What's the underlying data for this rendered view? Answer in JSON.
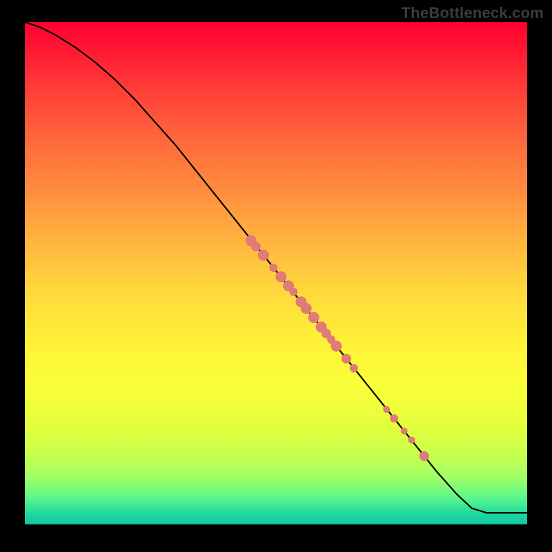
{
  "watermark": "TheBottleneck.com",
  "colors": {
    "gradient_top": "#ff0030",
    "gradient_mid": "#fff238",
    "gradient_bottom": "#10c9a0",
    "curve": "#000000",
    "marker_fill": "#e07b78",
    "marker_stroke": "#c95e5b"
  },
  "chart_data": {
    "type": "line",
    "title": "",
    "xlabel": "",
    "ylabel": "",
    "xlim": [
      0,
      100
    ],
    "ylim": [
      0,
      100
    ],
    "grid": false,
    "series": [
      {
        "name": "curve",
        "x": [
          0,
          3,
          6,
          10,
          14,
          18,
          22,
          26,
          30,
          34,
          38,
          42,
          46,
          50,
          54,
          58,
          62,
          66,
          70,
          74,
          78,
          82,
          86,
          89,
          92,
          100
        ],
        "y": [
          100,
          99,
          97.5,
          95,
          92,
          88.5,
          84.5,
          80,
          75.5,
          70.5,
          65.5,
          60.5,
          55.5,
          50.5,
          45.5,
          40.5,
          35.5,
          30.5,
          25.5,
          20.5,
          15.5,
          10.5,
          6,
          3.2,
          2.3,
          2.3
        ]
      }
    ],
    "markers": [
      {
        "x": 45.0,
        "y": 56.5,
        "r": 8
      },
      {
        "x": 46.0,
        "y": 55.3,
        "r": 7
      },
      {
        "x": 47.5,
        "y": 53.6,
        "r": 8
      },
      {
        "x": 49.5,
        "y": 51.1,
        "r": 6
      },
      {
        "x": 51.0,
        "y": 49.3,
        "r": 8
      },
      {
        "x": 52.5,
        "y": 47.5,
        "r": 8
      },
      {
        "x": 53.5,
        "y": 46.3,
        "r": 6
      },
      {
        "x": 55.0,
        "y": 44.3,
        "r": 8
      },
      {
        "x": 56.0,
        "y": 43.0,
        "r": 8
      },
      {
        "x": 57.5,
        "y": 41.2,
        "r": 8
      },
      {
        "x": 59.0,
        "y": 39.3,
        "r": 8
      },
      {
        "x": 60.0,
        "y": 38.0,
        "r": 7
      },
      {
        "x": 61.0,
        "y": 36.8,
        "r": 6
      },
      {
        "x": 62.0,
        "y": 35.5,
        "r": 8
      },
      {
        "x": 64.0,
        "y": 33.0,
        "r": 7
      },
      {
        "x": 65.5,
        "y": 31.1,
        "r": 6
      },
      {
        "x": 72.0,
        "y": 22.9,
        "r": 5
      },
      {
        "x": 73.5,
        "y": 21.1,
        "r": 6
      },
      {
        "x": 75.5,
        "y": 18.6,
        "r": 5
      },
      {
        "x": 77.0,
        "y": 16.8,
        "r": 5
      },
      {
        "x": 79.5,
        "y": 13.6,
        "r": 7
      }
    ]
  }
}
